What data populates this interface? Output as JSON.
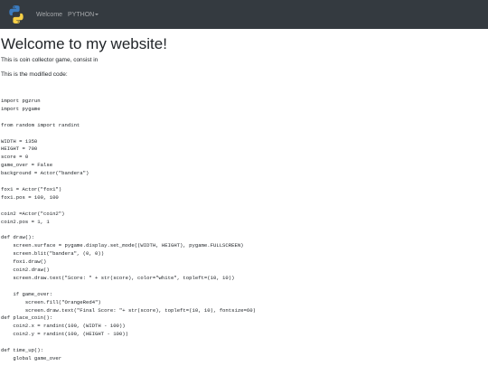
{
  "navbar": {
    "brand_logo": "python-logo-icon",
    "links": [
      {
        "label": "Welcome"
      },
      {
        "label": "PYTHON"
      }
    ]
  },
  "page": {
    "title": "Welcome to my website!",
    "intro": "This is coin collector game, consist in",
    "modified_label": "This is the modified code:"
  },
  "code": "import pgzrun\nimport pygame\n\nfrom random import randint\n\nWIDTH = 1350\nHEIGHT = 700\nscore = 0\ngame_over = False\nbackground = Actor(\"bandera\")\n\nfox1 = Actor(\"fox1\")\nfox1.pos = 100, 100\n\ncoin2 =Actor(\"coin2\")\ncoin2.pos = 1, 1\n\ndef draw():\n    screen.surface = pygame.display.set_mode((WIDTH, HEIGHT), pygame.FULLSCREEN)\n    screen.blit(\"bandera\", (0, 0))\n    fox1.draw()\n    coin2.draw()\n    screen.draw.text(\"Score: \" + str(score), color=\"white\", topleft=(10, 10))\n\n    if game_over:\n        screen.fill(\"OrangeRed4\")\n        screen.draw.text(\"Final Score: \"+ str(score), topleft=(10, 10), fontsize=60)\ndef place_coin():\n    coin2.x = randint(100, (WIDTH - 100))\n    coin2.y = randint(100, (HEIGHT - 100))\n\ndef time_up():\n    global game_over"
}
